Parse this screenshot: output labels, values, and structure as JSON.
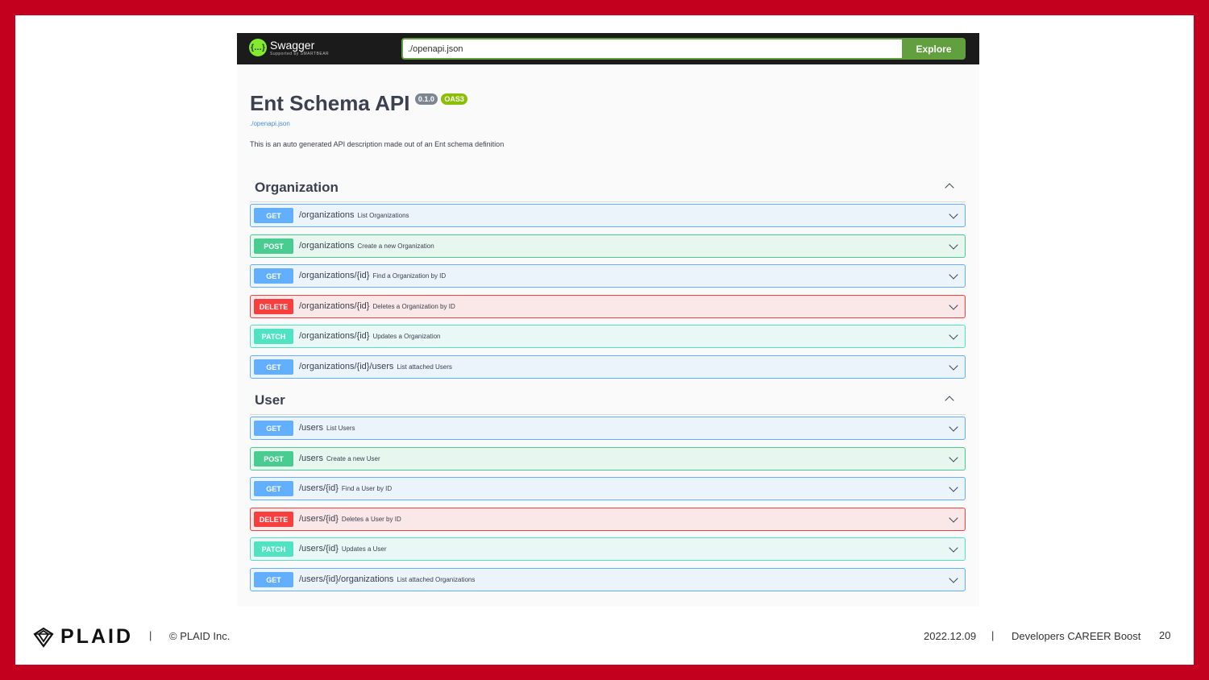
{
  "swagger": {
    "logo_text": "Swagger",
    "logo_sub": "Supported by SMARTBEAR",
    "url_value": "./openapi.json",
    "explore_label": "Explore",
    "title": "Ent Schema API",
    "version": "0.1.0",
    "oas": "OAS3",
    "spec_link": "./openapi.json",
    "description": "This is an auto generated API description made out of an Ent schema definition",
    "sections": [
      {
        "name": "Organization",
        "operations": [
          {
            "method": "GET",
            "path": "/organizations",
            "summary": "List Organizations"
          },
          {
            "method": "POST",
            "path": "/organizations",
            "summary": "Create a new Organization"
          },
          {
            "method": "GET",
            "path": "/organizations/{id}",
            "summary": "Find a Organization by ID"
          },
          {
            "method": "DELETE",
            "path": "/organizations/{id}",
            "summary": "Deletes a Organization by ID"
          },
          {
            "method": "PATCH",
            "path": "/organizations/{id}",
            "summary": "Updates a Organization"
          },
          {
            "method": "GET",
            "path": "/organizations/{id}/users",
            "summary": "List attached Users"
          }
        ]
      },
      {
        "name": "User",
        "operations": [
          {
            "method": "GET",
            "path": "/users",
            "summary": "List Users"
          },
          {
            "method": "POST",
            "path": "/users",
            "summary": "Create a new User"
          },
          {
            "method": "GET",
            "path": "/users/{id}",
            "summary": "Find a User by ID"
          },
          {
            "method": "DELETE",
            "path": "/users/{id}",
            "summary": "Deletes a User by ID"
          },
          {
            "method": "PATCH",
            "path": "/users/{id}",
            "summary": "Updates a User"
          },
          {
            "method": "GET",
            "path": "/users/{id}/organizations",
            "summary": "List attached Organizations"
          }
        ]
      }
    ]
  },
  "footer": {
    "brand": "PLAID",
    "separator": "|",
    "copyright": "© PLAID Inc.",
    "date": "2022.12.09",
    "event": "Developers CAREER Boost",
    "page": "20"
  },
  "colors": {
    "frame": "#c4001f",
    "get": "#61affe",
    "post": "#49cc90",
    "delete": "#f93e3e",
    "patch": "#50e3c2",
    "explore": "#62a03f"
  }
}
